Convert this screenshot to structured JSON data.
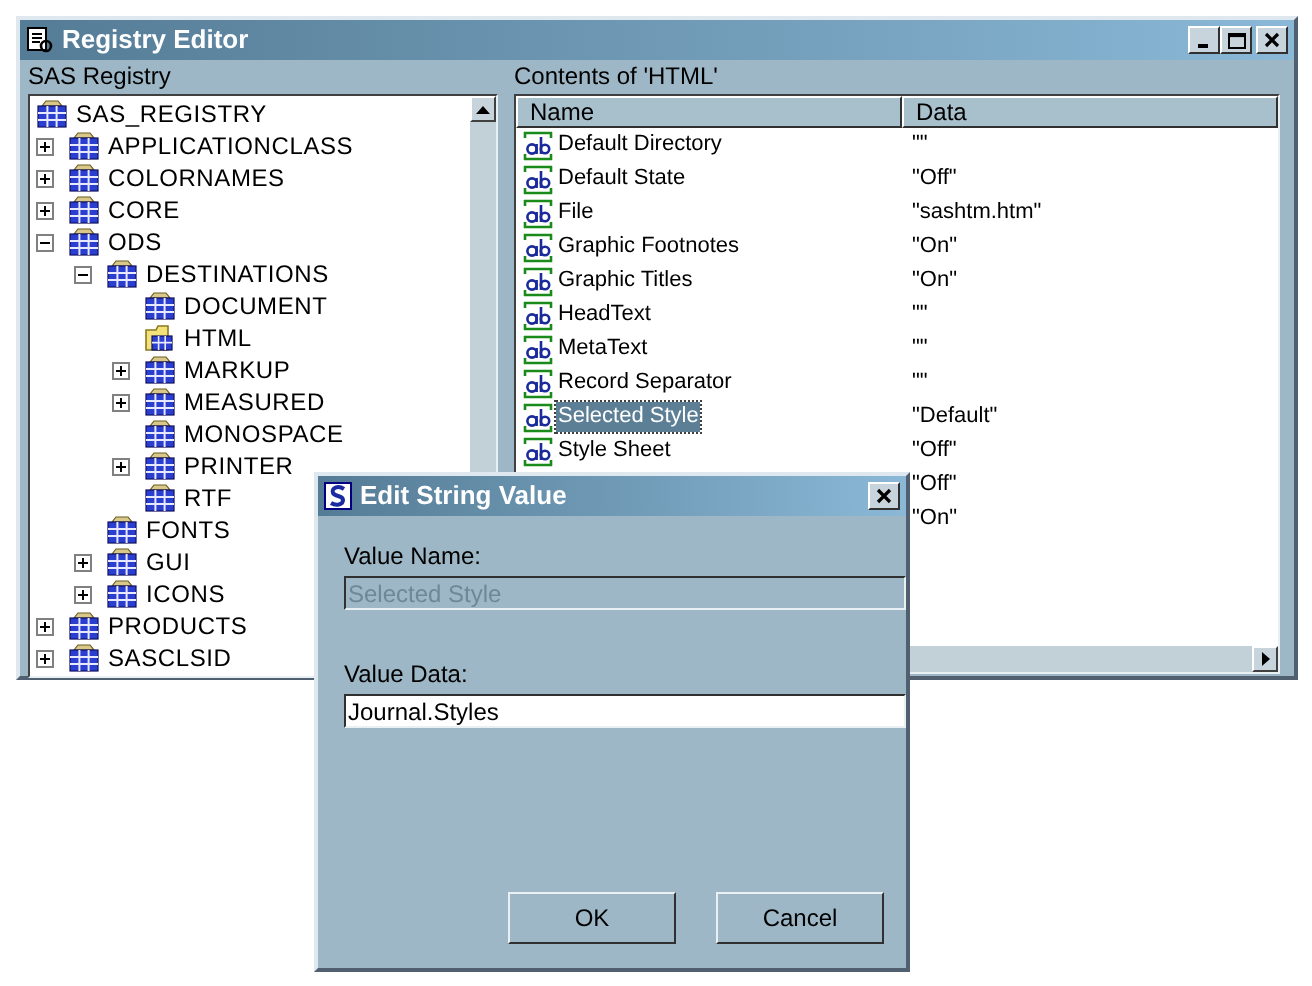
{
  "window": {
    "title": "Registry Editor"
  },
  "tree": {
    "label": "SAS Registry",
    "root": {
      "name": "SAS_REGISTRY",
      "selected": false,
      "children": [
        {
          "name": "APPLICATIONCLASS",
          "selected": false,
          "expanded": false
        },
        {
          "name": "COLORNAMES",
          "selected": false,
          "expanded": false
        },
        {
          "name": "CORE",
          "selected": false,
          "expanded": false
        },
        {
          "name": "ODS",
          "selected": false,
          "expanded": true,
          "children": [
            {
              "name": "DESTINATIONS",
              "selected": false,
              "expanded": true,
              "children": [
                {
                  "name": "DOCUMENT",
                  "selected": false
                },
                {
                  "name": "HTML",
                  "selected": true
                },
                {
                  "name": "MARKUP",
                  "selected": false,
                  "expanded": false
                },
                {
                  "name": "MEASURED",
                  "selected": false,
                  "expanded": false
                },
                {
                  "name": "MONOSPACE",
                  "selected": false
                },
                {
                  "name": "PRINTER",
                  "selected": false,
                  "expanded": false
                },
                {
                  "name": "RTF",
                  "selected": false
                }
              ]
            },
            {
              "name": "FONTS",
              "selected": false
            },
            {
              "name": "GUI",
              "selected": false,
              "expanded": false
            },
            {
              "name": "ICONS",
              "selected": false,
              "expanded": false
            }
          ]
        },
        {
          "name": "PRODUCTS",
          "selected": false,
          "expanded": false
        },
        {
          "name": "SASCLSID",
          "selected": false,
          "expanded": false
        }
      ]
    }
  },
  "contents": {
    "label": "Contents of 'HTML'",
    "columns": [
      "Name",
      "Data"
    ],
    "rows": [
      {
        "name": "Default Directory",
        "data": "\"\"",
        "selected": false
      },
      {
        "name": "Default State",
        "data": "\"Off\"",
        "selected": false
      },
      {
        "name": "File",
        "data": "\"sashtm.htm\"",
        "selected": false
      },
      {
        "name": "Graphic Footnotes",
        "data": "\"On\"",
        "selected": false
      },
      {
        "name": "Graphic Titles",
        "data": "\"On\"",
        "selected": false
      },
      {
        "name": "HeadText",
        "data": "\"\"",
        "selected": false
      },
      {
        "name": "MetaText",
        "data": "\"\"",
        "selected": false
      },
      {
        "name": "Record Separator",
        "data": "\"\"",
        "selected": false
      },
      {
        "name": "Selected Style",
        "data": "\"Default\"",
        "selected": true
      },
      {
        "name": "Style Sheet",
        "data": "\"Off\"",
        "selected": false
      },
      {
        "data": "\"Off\"",
        "selected": false
      },
      {
        "data": "\"On\"",
        "selected": false
      }
    ]
  },
  "dialog": {
    "title": "Edit String Value",
    "fields": [
      {
        "label": "Value Name:",
        "value": "Selected Style",
        "disabled": true
      },
      {
        "label": "Value Data:",
        "value": "Journal.Styles",
        "disabled": false
      }
    ],
    "buttons": [
      "OK",
      "Cancel"
    ]
  }
}
